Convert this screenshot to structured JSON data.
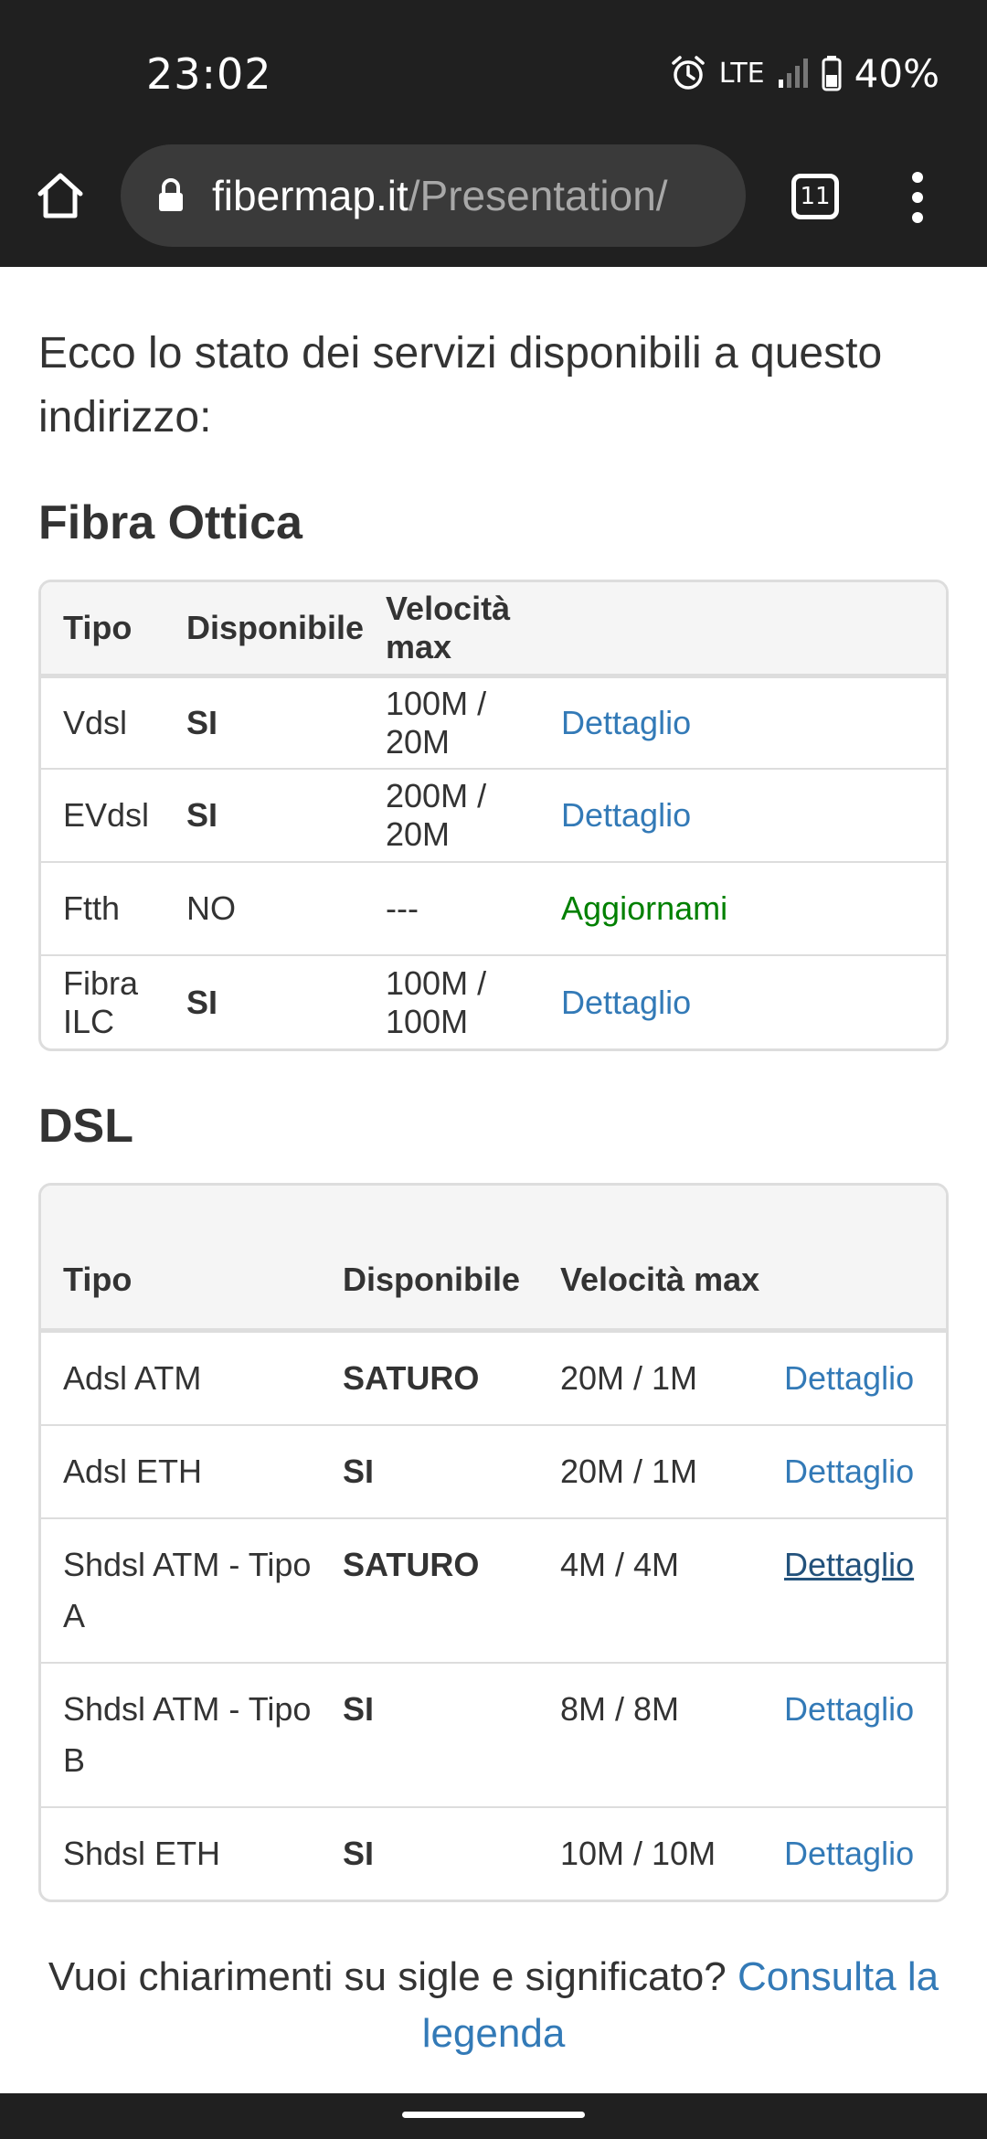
{
  "status_bar": {
    "time": "23:02",
    "network": "LTE",
    "battery": "40%",
    "icons": [
      "alarm-icon",
      "signal-icon",
      "battery-icon"
    ]
  },
  "browser": {
    "url_domain": "fibermap.it",
    "url_path": "/Presentation/",
    "tab_count": "11"
  },
  "page": {
    "intro": "Ecco lo stato dei servizi disponibili a questo indirizzo:",
    "fibra": {
      "title": "Fibra Ottica",
      "headers": [
        "Tipo",
        "Disponibile",
        "Velocità max",
        ""
      ],
      "rows": [
        {
          "tipo": "Vdsl",
          "disponibile": "SI",
          "velocita": "100M / 20M",
          "action": "Dettaglio"
        },
        {
          "tipo": "EVdsl",
          "disponibile": "SI",
          "velocita": "200M / 20M",
          "action": "Dettaglio"
        },
        {
          "tipo": "Ftth",
          "disponibile": "NO",
          "velocita": "---",
          "action": "Aggiornami"
        },
        {
          "tipo": "Fibra ILC",
          "disponibile": "SI",
          "velocita": "100M / 100M",
          "action": "Dettaglio"
        }
      ]
    },
    "dsl": {
      "title": "DSL",
      "headers": [
        "Tipo",
        "Disponibile",
        "Velocità max",
        ""
      ],
      "rows": [
        {
          "tipo": "Adsl ATM",
          "disponibile": "SATURO",
          "velocita": "20M / 1M",
          "action": "Dettaglio"
        },
        {
          "tipo": "Adsl ETH",
          "disponibile": "SI",
          "velocita": "20M / 1M",
          "action": "Dettaglio"
        },
        {
          "tipo": "Shdsl ATM - Tipo A",
          "disponibile": "SATURO",
          "velocita": "4M / 4M",
          "action": "Dettaglio"
        },
        {
          "tipo": "Shdsl ATM - Tipo B",
          "disponibile": "SI",
          "velocita": "8M / 8M",
          "action": "Dettaglio"
        },
        {
          "tipo": "Shdsl ETH",
          "disponibile": "SI",
          "velocita": "10M / 10M",
          "action": "Dettaglio"
        }
      ]
    },
    "footer": {
      "question": "Vuoi chiarimenti su sigle e significato?",
      "link": "Consulta la legenda"
    }
  },
  "colors": {
    "link": "#337ab7",
    "green": "#008000",
    "bar": "#202020"
  }
}
